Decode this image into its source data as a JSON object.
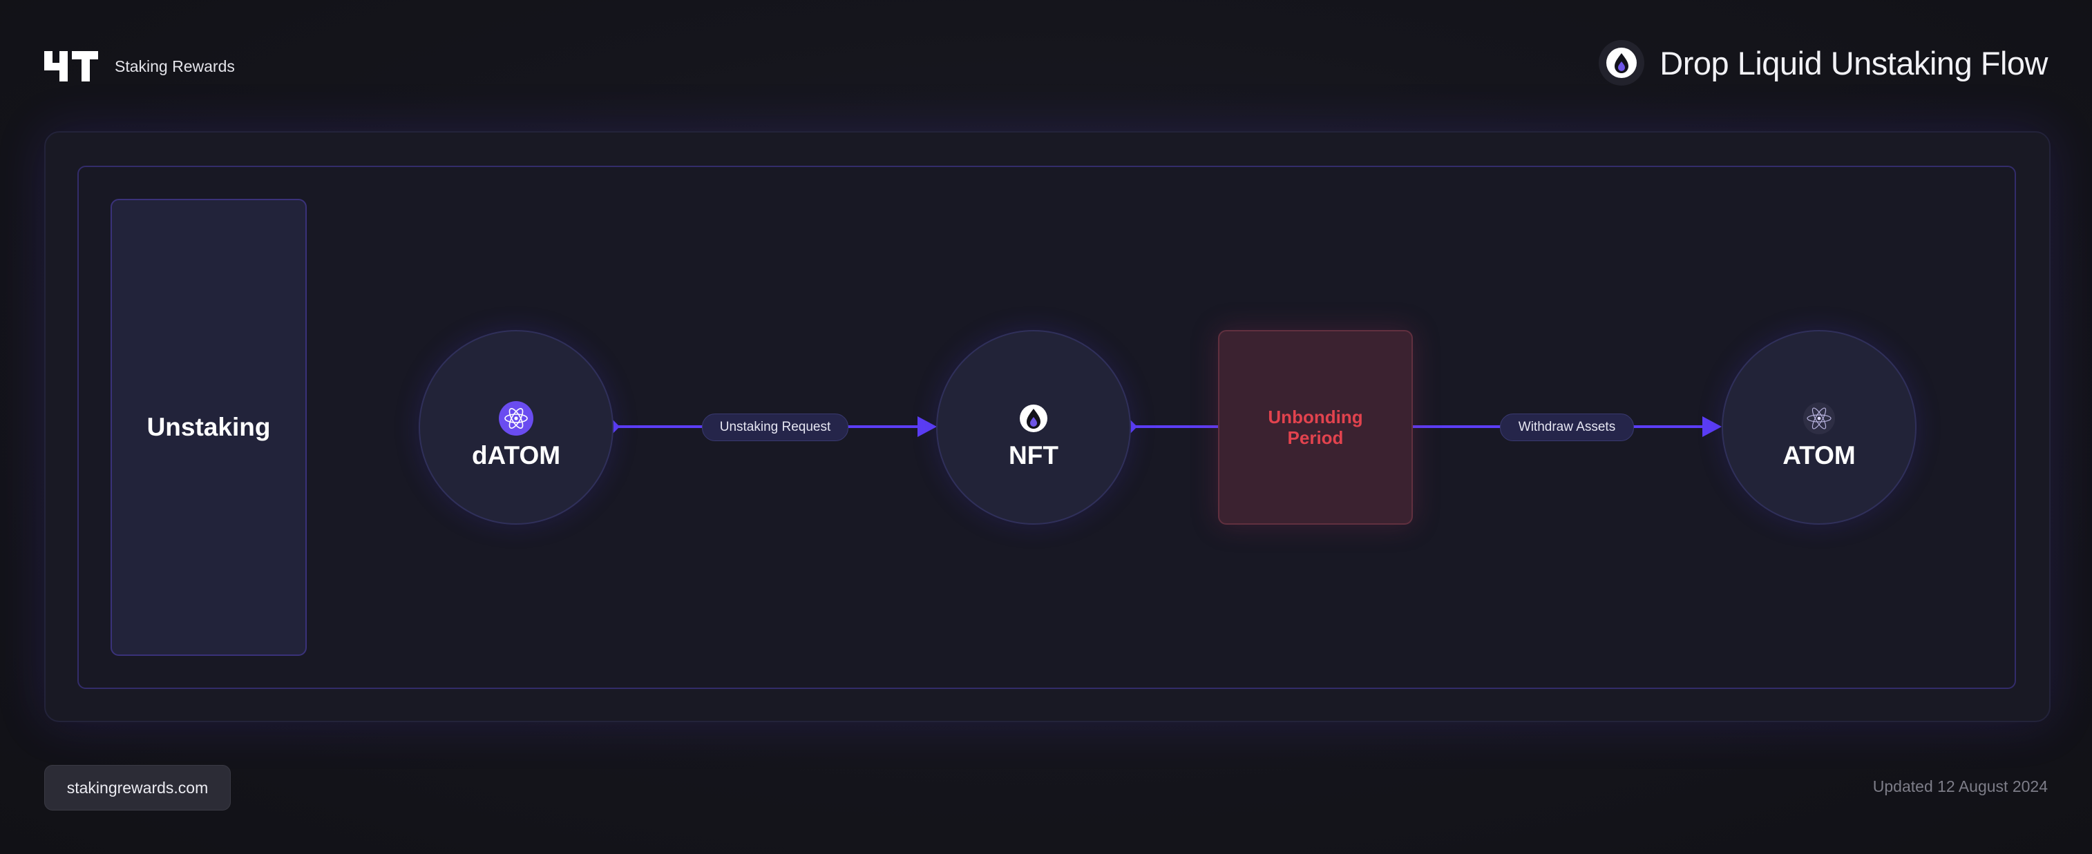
{
  "header": {
    "brand_name": "Staking Rewards",
    "title": "Drop Liquid Unstaking Flow",
    "brand_logo_icon": "staking-rewards-logo",
    "title_icon": "drop-icon"
  },
  "diagram": {
    "section_label": "Unstaking",
    "nodes": [
      {
        "label": "dATOM",
        "icon": "atom-icon",
        "icon_color": "#6a4cf0"
      },
      {
        "label": "NFT",
        "icon": "drop-icon"
      },
      {
        "label": "ATOM",
        "icon": "cosmos-icon"
      }
    ],
    "unbonding_label": "Unbonding Period",
    "edges": [
      {
        "from": "dATOM",
        "to": "NFT",
        "label": "Unstaking Request"
      },
      {
        "from": "NFT",
        "to": "Unbonding Period",
        "label": ""
      },
      {
        "from": "Unbonding Period",
        "to": "ATOM",
        "label": "Withdraw Assets"
      }
    ]
  },
  "footer": {
    "website": "stakingrewards.com",
    "updated": "Updated 12 August 2024"
  },
  "colors": {
    "accent": "#5b3df5",
    "unbonding_text": "#e2434e",
    "unbonding_bg": "#3b2230",
    "background": "#15151c"
  }
}
